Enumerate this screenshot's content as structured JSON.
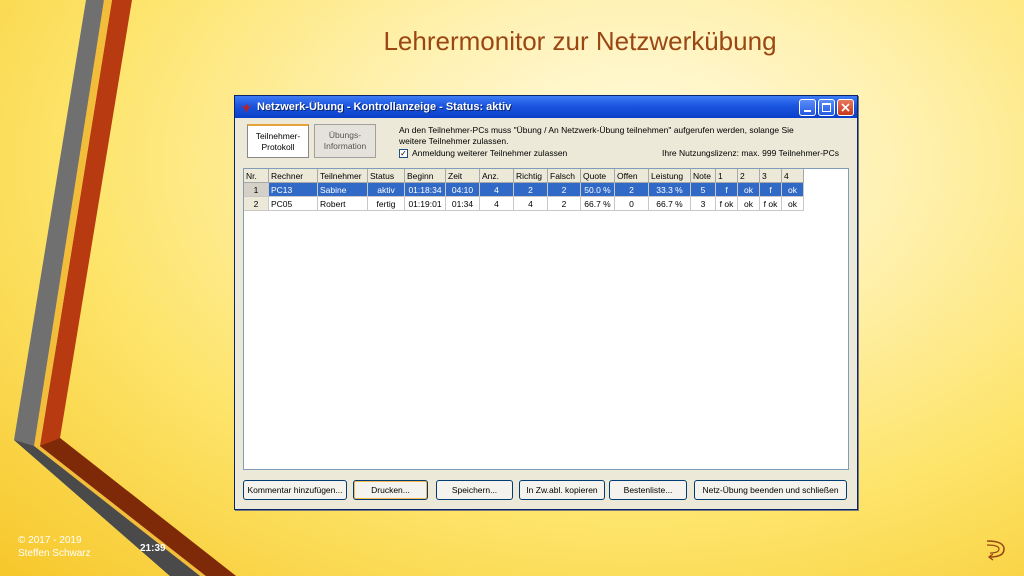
{
  "slide": {
    "title": "Lehrermonitor zur Netzwerkübung",
    "copyright": "© 2017 - 2019",
    "author": "Steffen Schwarz",
    "time": "21:39",
    "next_icon": "curved-arrow-icon"
  },
  "window": {
    "title": "Netzwerk-Übung - Kontrollanzeige - Status: aktiv",
    "icons": {
      "app": "bird-icon",
      "minimize": "minimize-icon",
      "maximize": "maximize-icon",
      "close": "close-icon"
    },
    "tabs": [
      {
        "line1": "Teilnehmer-",
        "line2": "Protokoll",
        "active": true
      },
      {
        "line1": "Übungs-",
        "line2": "Information",
        "active": false
      }
    ],
    "info": {
      "line1": "An den Teilnehmer-PCs muss \"Übung / An Netzwerk-Übung teilnehmen\" aufgerufen werden, solange Sie",
      "line2": "weitere Teilnehmer zulassen.",
      "checkbox_label": "Anmeldung weiterer Teilnehmer zulassen",
      "checkbox_checked": true,
      "checkbox_mark": "✓",
      "license": "Ihre Nutzungslizenz: max. 999 Teilnehmer-PCs"
    },
    "table": {
      "columns": [
        "Nr.",
        "Rechner",
        "Teilnehmer",
        "Status",
        "Beginn",
        "Zeit",
        "Anz.",
        "Richtig",
        "Falsch",
        "Quote",
        "Offen",
        "Leistung",
        "Note",
        "1",
        "2",
        "3",
        "4"
      ],
      "rows": [
        [
          "1",
          "PC13",
          "Sabine",
          "aktiv",
          "01:18:34",
          "04:10",
          "4",
          "2",
          "2",
          "50.0 %",
          "2",
          "33.3 %",
          "5",
          "f",
          "ok",
          "f",
          "ok"
        ],
        [
          "2",
          "PC05",
          "Robert",
          "fertig",
          "01:19:01",
          "01:34",
          "4",
          "4",
          "2",
          "66.7 %",
          "0",
          "66.7 %",
          "3",
          "f ok",
          "ok",
          "f ok",
          "ok"
        ]
      ],
      "selected_row": 0
    },
    "buttons": {
      "comment": "Kommentar hinzufügen...",
      "print": "Drucken...",
      "save": "Speichern...",
      "copy": "In Zw.abl. kopieren",
      "best": "Bestenliste...",
      "end": "Netz-Übung beenden und schließen"
    }
  }
}
